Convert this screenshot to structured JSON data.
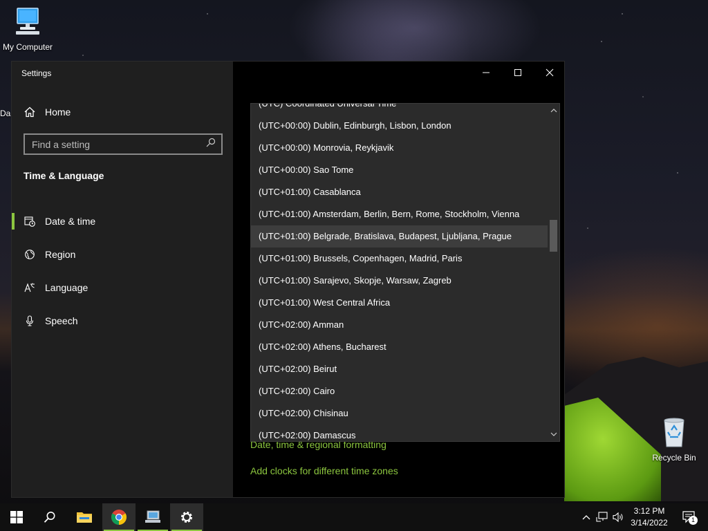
{
  "desktop": {
    "icons": [
      {
        "label": "My Computer",
        "name": "my-computer-icon"
      },
      {
        "label": "Recycle Bin",
        "name": "recycle-bin-icon"
      }
    ],
    "side_label": "Da"
  },
  "window": {
    "title": "Settings",
    "home_label": "Home",
    "search_placeholder": "Find a setting",
    "section_title": "Time & Language",
    "nav_items": [
      {
        "label": "Date & time",
        "icon": "date-time-icon",
        "active": true
      },
      {
        "label": "Region",
        "icon": "globe-icon",
        "active": false
      },
      {
        "label": "Language",
        "icon": "language-icon",
        "active": false
      },
      {
        "label": "Speech",
        "icon": "microphone-icon",
        "active": false
      }
    ]
  },
  "content": {
    "links": {
      "regional": "Date, time & regional formatting",
      "clocks": "Add clocks for different time zones"
    }
  },
  "timezone_dropdown": {
    "hovered_index": 6,
    "options": [
      "(UTC) Coordinated Universal Time",
      "(UTC+00:00) Dublin, Edinburgh, Lisbon, London",
      "(UTC+00:00) Monrovia, Reykjavik",
      "(UTC+00:00) Sao Tome",
      "(UTC+01:00) Casablanca",
      "(UTC+01:00) Amsterdam, Berlin, Bern, Rome, Stockholm, Vienna",
      "(UTC+01:00) Belgrade, Bratislava, Budapest, Ljubljana, Prague",
      "(UTC+01:00) Brussels, Copenhagen, Madrid, Paris",
      "(UTC+01:00) Sarajevo, Skopje, Warsaw, Zagreb",
      "(UTC+01:00) West Central Africa",
      "(UTC+02:00) Amman",
      "(UTC+02:00) Athens, Bucharest",
      "(UTC+02:00) Beirut",
      "(UTC+02:00) Cairo",
      "(UTC+02:00) Chisinau",
      "(UTC+02:00) Damascus"
    ]
  },
  "taskbar": {
    "time": "3:12 PM",
    "date": "3/14/2022",
    "notification_count": "1",
    "accent": "#8cc63f"
  }
}
